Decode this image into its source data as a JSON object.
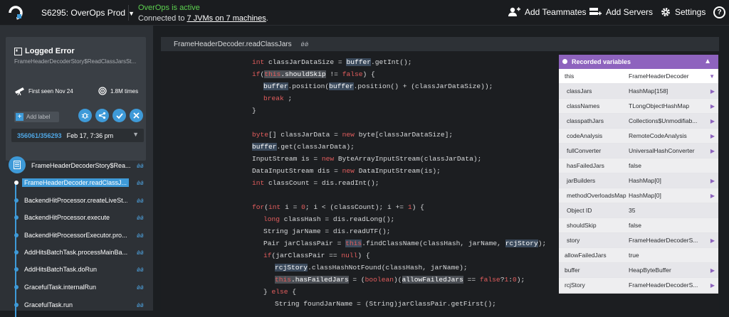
{
  "topbar": {
    "env_label": "S6295: OverOps Prod",
    "status_title": "OverOps is active",
    "status_text_prefix": "Connected to ",
    "status_link": "7 JVMs on 7 machines",
    "status_text_suffix": ".",
    "add_teammates": "Add Teammates",
    "add_servers": "Add Servers",
    "settings": "Settings",
    "help": "?"
  },
  "error": {
    "title": "Logged Error",
    "subtitle": "FrameHeaderDecoderStory$ReadClassJarsSt...",
    "first_seen": "First seen Nov 24",
    "times": "1.8M times",
    "add_label": "Add label",
    "snapshot_id": "356061/356293",
    "snapshot_date": "Feb 17, 7:36 pm"
  },
  "stack": [
    {
      "label": "FrameHeaderDecoderStory$Rea...",
      "type": "root"
    },
    {
      "label": "FrameHeaderDecoder.readClassJ...",
      "type": "selected"
    },
    {
      "label": "BackendHitProcessor.createLiveSt...",
      "type": "normal"
    },
    {
      "label": "BackendHitProcessor.execute",
      "type": "normal"
    },
    {
      "label": "BackendHitProcessorExecutor.pro...",
      "type": "normal"
    },
    {
      "label": "AddHitsBatchTask.processMainBa...",
      "type": "normal"
    },
    {
      "label": "AddHitsBatchTask.doRun",
      "type": "normal"
    },
    {
      "label": "GracefulTask.internalRun",
      "type": "normal"
    },
    {
      "label": "GracefulTask.run",
      "type": "normal"
    }
  ],
  "code_header": "FrameHeaderDecoder.readClassJars",
  "variables": {
    "title": "Recorded variables",
    "rows": [
      {
        "name": "this",
        "value": "FrameHeaderDecoder",
        "expand": "down"
      },
      {
        "name": "classJars",
        "value": "HashMap[158]",
        "expand": "right"
      },
      {
        "name": "classNames",
        "value": "TLongObjectHashMap",
        "expand": "right"
      },
      {
        "name": "classpathJars",
        "value": "Collections$Unmodifiab...",
        "expand": "right"
      },
      {
        "name": "codeAnalysis",
        "value": "RemoteCodeAnalysis",
        "expand": "right"
      },
      {
        "name": "fullConverter",
        "value": "UniversalHashConverter",
        "expand": "right"
      },
      {
        "name": "hasFailedJars",
        "value": "false",
        "expand": ""
      },
      {
        "name": "jarBuilders",
        "value": "HashMap[0]",
        "expand": "right"
      },
      {
        "name": "methodOverloadsMap",
        "value": "HashMap[0]",
        "expand": "right"
      },
      {
        "name": "Object ID",
        "value": "35",
        "expand": ""
      },
      {
        "name": "shouldSkip",
        "value": "false",
        "expand": ""
      },
      {
        "name": "story",
        "value": "FrameHeaderDecoderS...",
        "expand": "right"
      },
      {
        "name": "allowFailedJars",
        "value": "true",
        "expand": ""
      },
      {
        "name": "buffer",
        "value": "HeapByteBuffer",
        "expand": "right"
      },
      {
        "name": "rcjStory",
        "value": "FrameHeaderDecoderS...",
        "expand": "right"
      }
    ]
  },
  "colors": {
    "accent": "#3e9ad8",
    "active_green": "#5cd04f",
    "vars_header": "#8e63be",
    "keyword": "#e35d5d"
  }
}
